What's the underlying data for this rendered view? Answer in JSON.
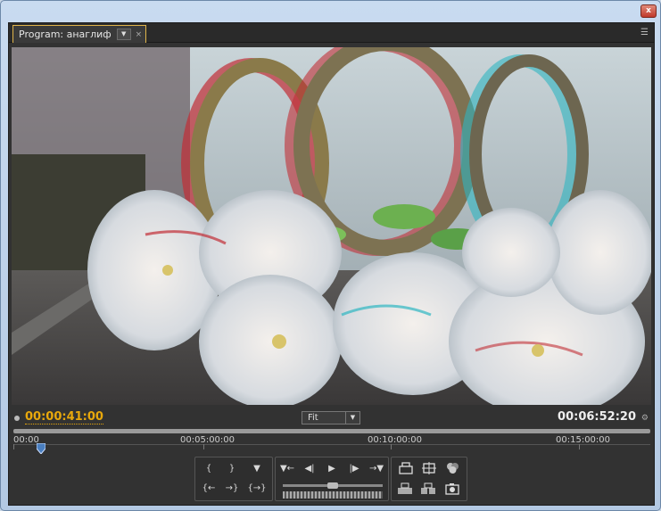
{
  "window": {
    "close_glyph": "x"
  },
  "panel": {
    "tab_label": "Program: анаглиф",
    "tab_dropdown_glyph": "▼",
    "tab_close_glyph": "×",
    "panel_menu_glyph": "☰"
  },
  "timebar": {
    "current_timecode": "00:00:41:00",
    "zoom_select": "Fit",
    "duration_timecode": "00:06:52:20"
  },
  "ruler": {
    "labels": [
      "00:00",
      "00:05:00:00",
      "00:10:00:00",
      "00:15:00:00"
    ]
  },
  "controls": {
    "group1": [
      "{",
      "}",
      "▼",
      "{←",
      "→}",
      "{→}"
    ],
    "group2": [
      "▼←",
      "◀|",
      "▶",
      "|▶",
      "→▼"
    ],
    "group3": [
      "lift-icon",
      "extract-icon",
      "trim-icon",
      "export-frame-icon"
    ]
  },
  "colors": {
    "accent": "#e8a80c",
    "panel": "#323232"
  }
}
